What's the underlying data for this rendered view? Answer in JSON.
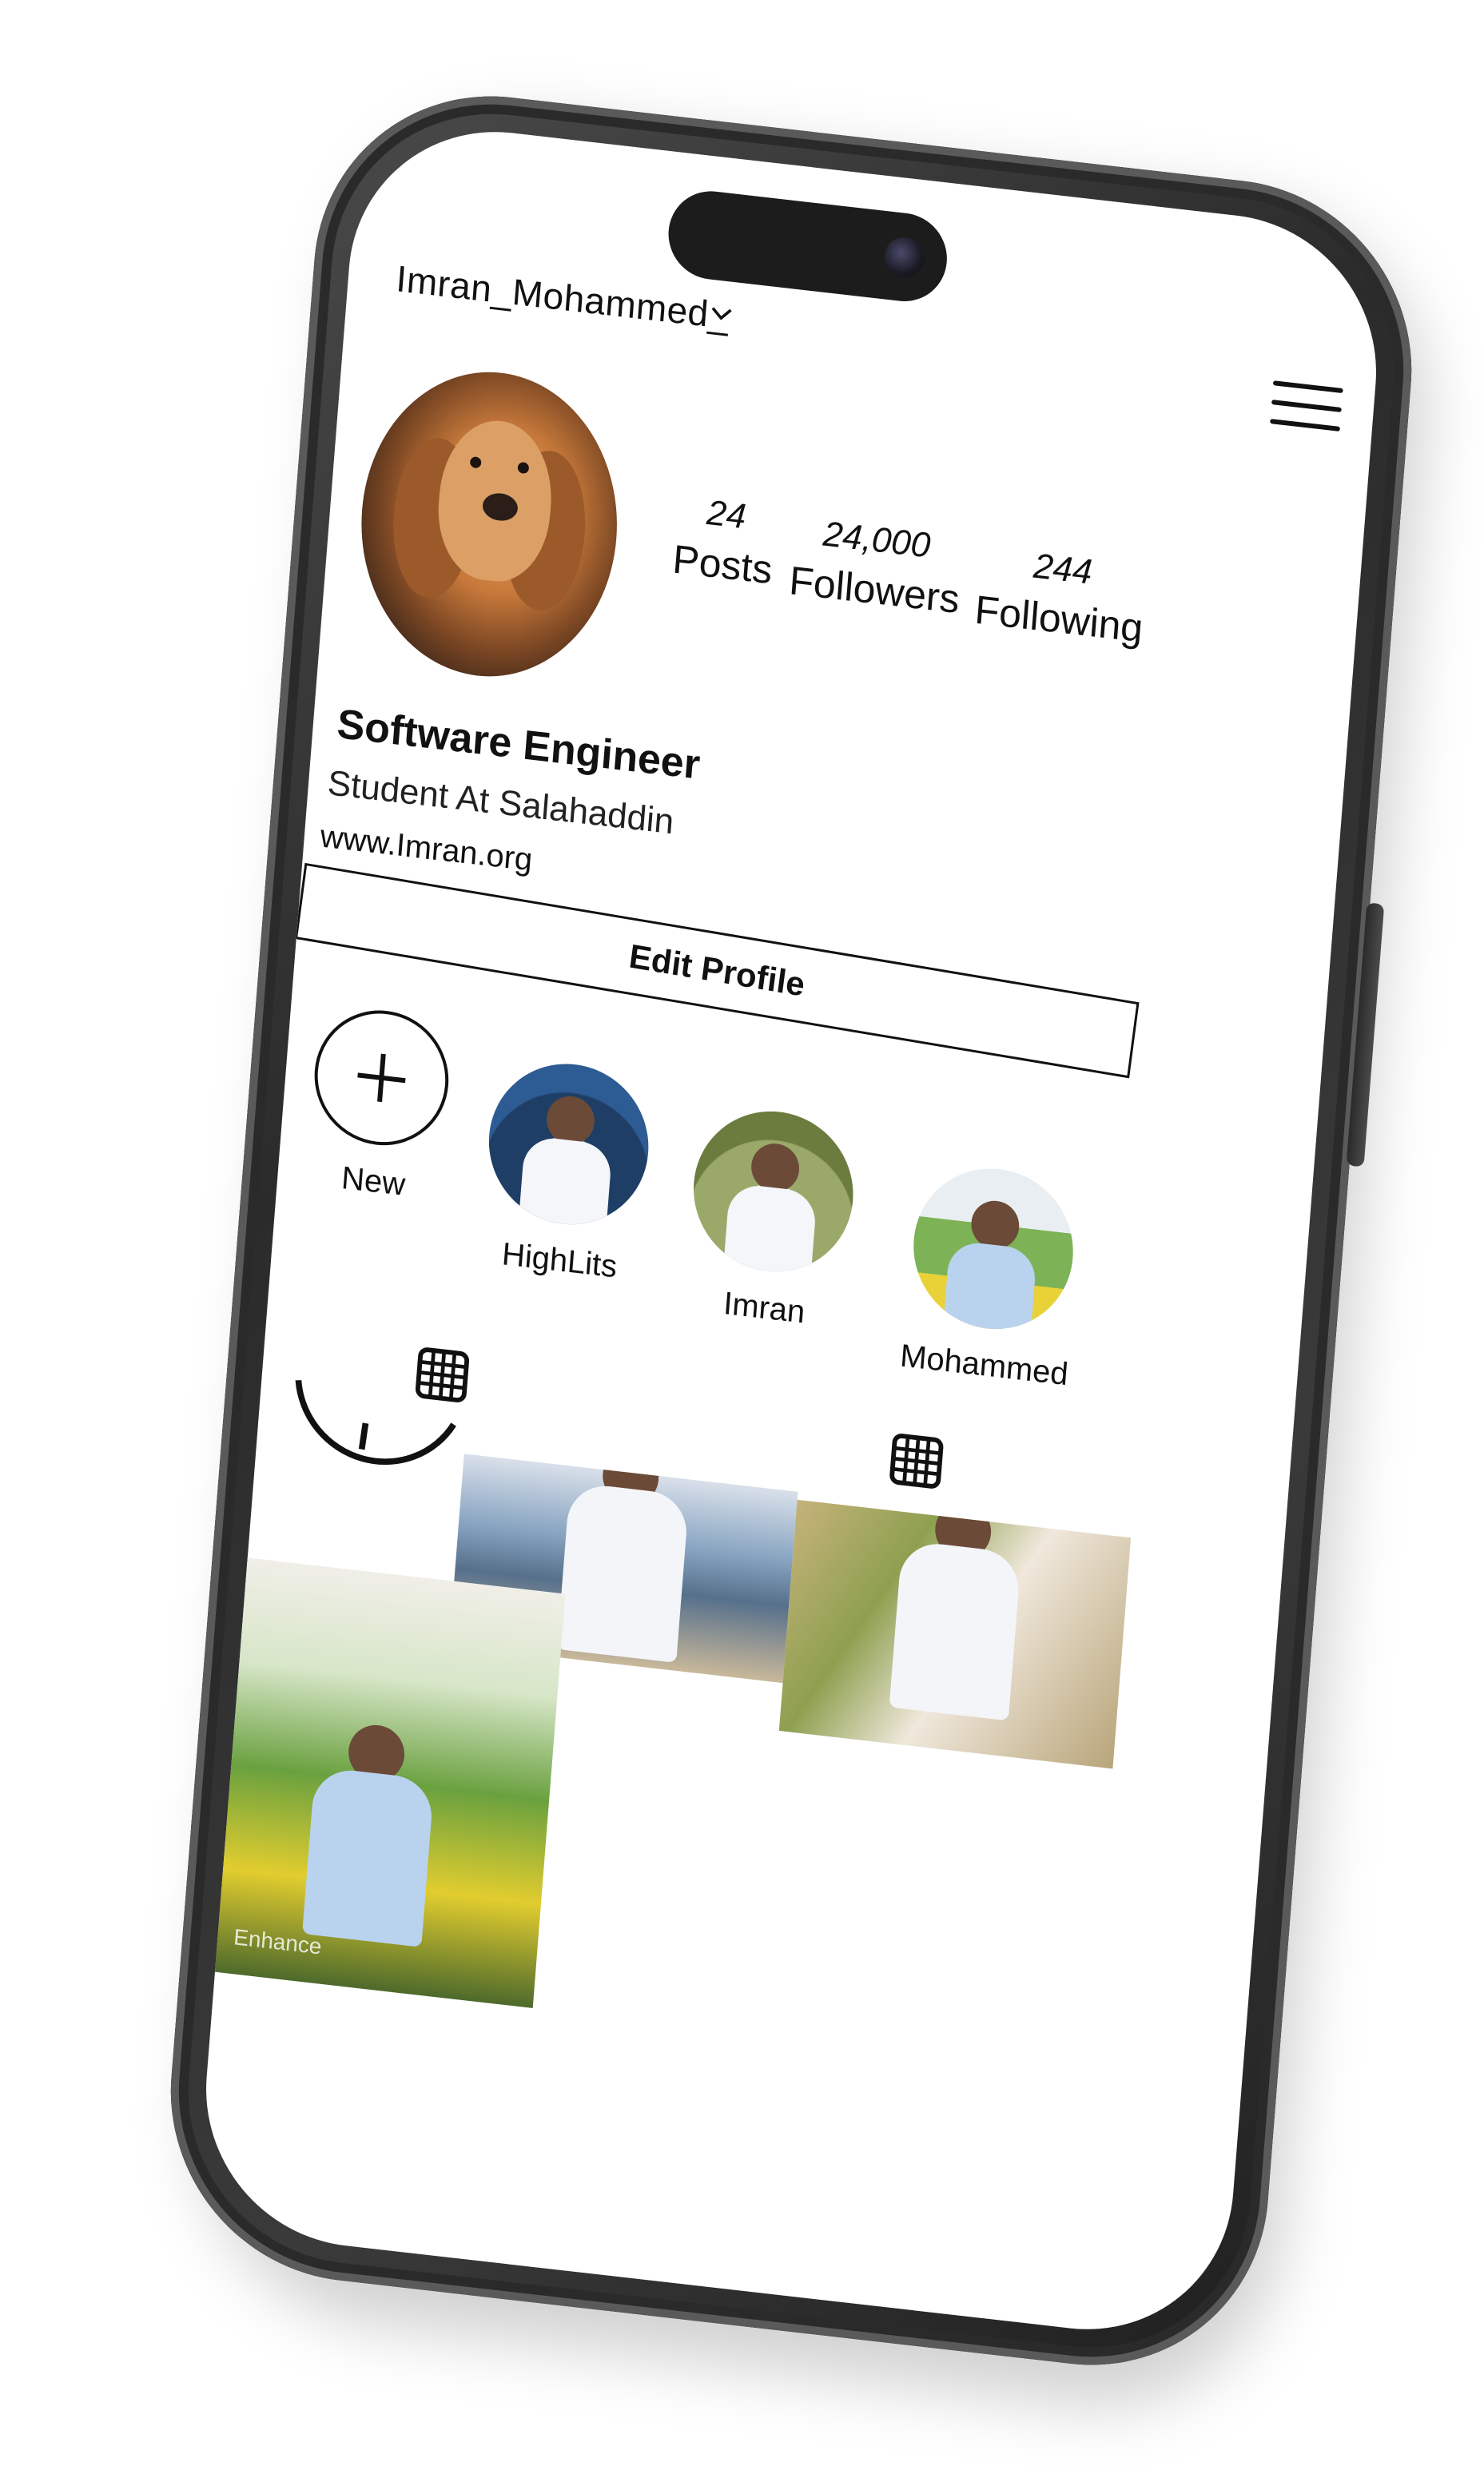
{
  "profile": {
    "username": "Imran_Mohammed_",
    "stats": [
      {
        "value": "24",
        "label": "Posts"
      },
      {
        "value": "24,000",
        "label": "Followers"
      },
      {
        "value": "244",
        "label": "Following"
      }
    ],
    "bio_title": "Software Engineer",
    "bio_subtitle": "Student At Salahaddin",
    "website": "www.Imran.org",
    "edit_button": "Edit Profile"
  },
  "highlights": [
    {
      "label": "New"
    },
    {
      "label": "HighLits"
    },
    {
      "label": "Imran"
    },
    {
      "label": "Mohammed"
    }
  ],
  "watermark": "Enhance",
  "icons": {
    "menu": "hamburger-menu-icon",
    "dropdown": "chevron-down-icon",
    "grid": "grid-icon",
    "add": "plus-icon"
  }
}
